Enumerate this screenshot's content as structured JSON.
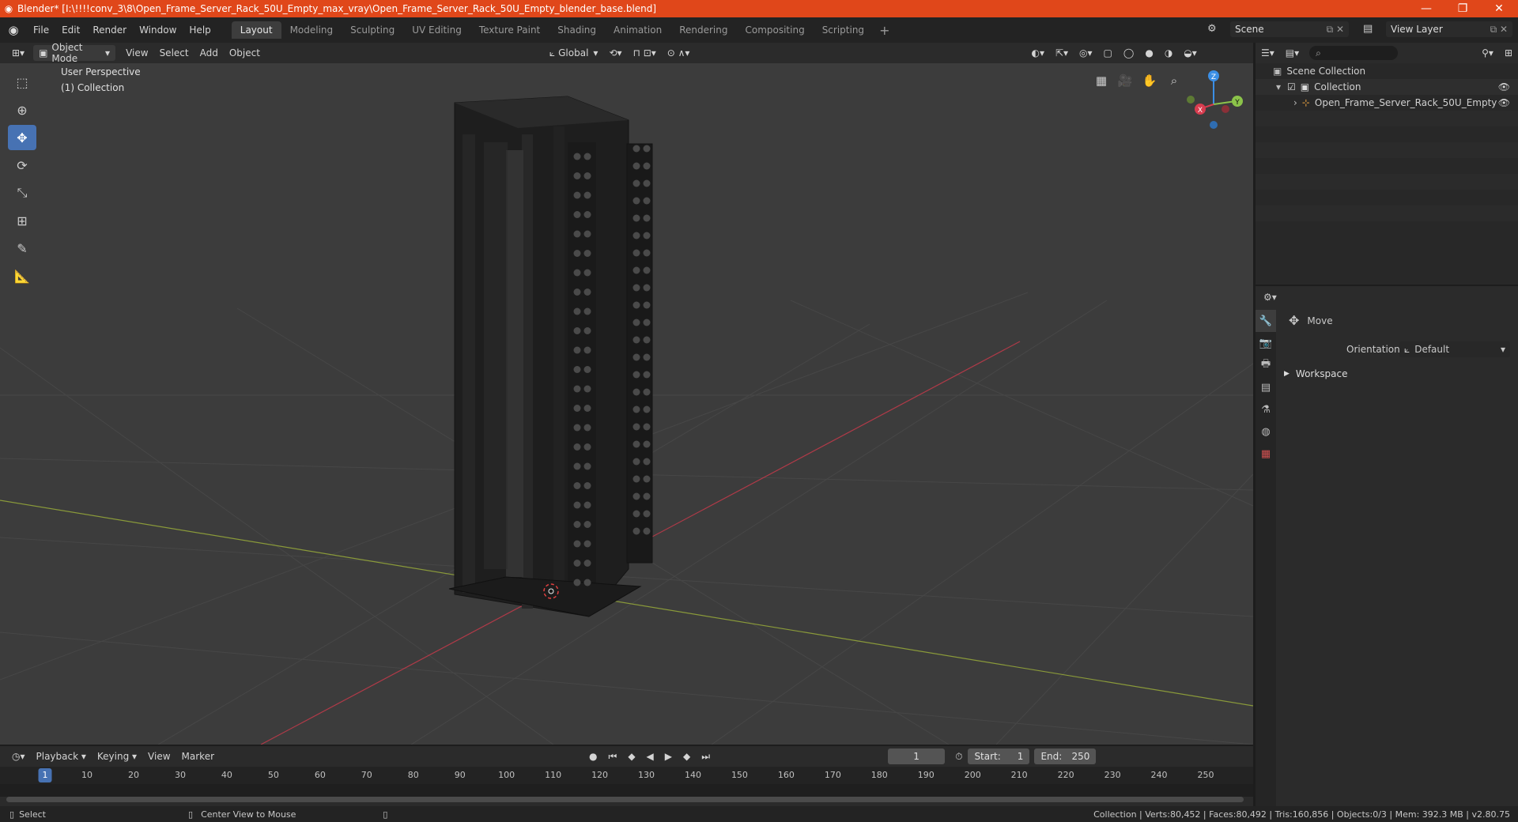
{
  "window": {
    "title": "Blender* [I:\\!!!!conv_3\\8\\Open_Frame_Server_Rack_50U_Empty_max_vray\\Open_Frame_Server_Rack_50U_Empty_blender_base.blend]",
    "minimize": "—",
    "restore": "❐",
    "close": "✕"
  },
  "menu": {
    "items": [
      "File",
      "Edit",
      "Render",
      "Window",
      "Help"
    ],
    "tabs": [
      "Layout",
      "Modeling",
      "Sculpting",
      "UV Editing",
      "Texture Paint",
      "Shading",
      "Animation",
      "Rendering",
      "Compositing",
      "Scripting"
    ],
    "add_tab": "+",
    "scene_label": "Scene",
    "view_layer_label": "View Layer"
  },
  "viewport_header": {
    "mode": "Object Mode",
    "menus": [
      "View",
      "Select",
      "Add",
      "Object"
    ],
    "orientation": "Global"
  },
  "viewport": {
    "perspective_label": "User Perspective",
    "collection_label": "(1) Collection",
    "gizmo": {
      "x": "X",
      "y": "Y",
      "z": "Z"
    }
  },
  "outliner": {
    "search_placeholder": "",
    "rows": [
      {
        "label": "Scene Collection"
      },
      {
        "label": "Collection"
      },
      {
        "label": "Open_Frame_Server_Rack_50U_Empty"
      }
    ]
  },
  "properties": {
    "tool_name": "Move",
    "orientation_label": "Orientation",
    "orientation_value": "Default",
    "workspace_label": "Workspace"
  },
  "timeline": {
    "menus": [
      "Playback",
      "Keying",
      "View",
      "Marker"
    ],
    "current_frame": "1",
    "start_label": "Start:",
    "start_value": "1",
    "end_label": "End:",
    "end_value": "250",
    "ticks": [
      "1",
      "10",
      "20",
      "30",
      "40",
      "50",
      "60",
      "70",
      "80",
      "90",
      "100",
      "110",
      "120",
      "130",
      "140",
      "150",
      "160",
      "170",
      "180",
      "190",
      "200",
      "210",
      "220",
      "230",
      "240",
      "250"
    ]
  },
  "statusbar": {
    "select": "Select",
    "center_view": "Center View to Mouse",
    "stats": "Collection | Verts:80,452 | Faces:80,492 | Tris:160,856 | Objects:0/3 | Mem: 392.3 MB | v2.80.75"
  },
  "colors": {
    "titlebar": "#e0471a",
    "active_tool": "#4772b3",
    "x_axis": "#d83c4f",
    "y_axis": "#8bc34a",
    "z_axis": "#3b8fe6"
  }
}
